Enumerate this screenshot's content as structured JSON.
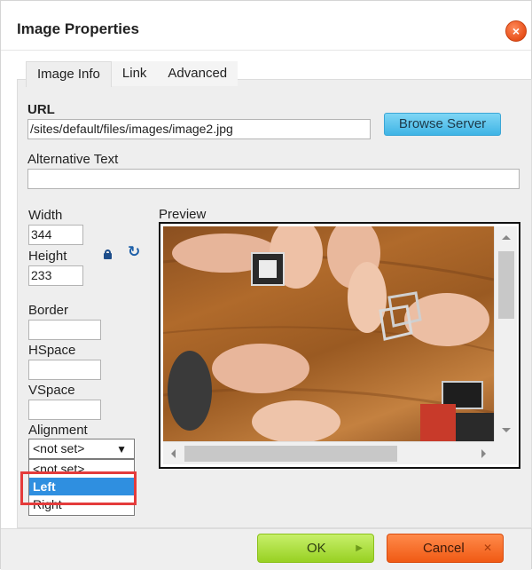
{
  "dialog": {
    "title": "Image Properties",
    "close_icon": "close-icon"
  },
  "tabs": [
    {
      "label": "Image Info",
      "active": true
    },
    {
      "label": "Link",
      "active": false
    },
    {
      "label": "Advanced",
      "active": false
    }
  ],
  "url": {
    "label": "URL",
    "value": "/sites/default/files/images/image2.jpg"
  },
  "browse_button": {
    "label": "Browse Server"
  },
  "alt_text": {
    "label": "Alternative Text",
    "value": ""
  },
  "width": {
    "label": "Width",
    "value": "344"
  },
  "height": {
    "label": "Height",
    "value": "233"
  },
  "lock_icon": "lock-icon",
  "reset_icon": "refresh-icon",
  "border": {
    "label": "Border",
    "value": ""
  },
  "hspace": {
    "label": "HSpace",
    "value": ""
  },
  "vspace": {
    "label": "VSpace",
    "value": ""
  },
  "alignment": {
    "label": "Alignment",
    "selected": "<not set>",
    "options": [
      "<not set>",
      "Left",
      "Right"
    ],
    "highlighted": "Left"
  },
  "preview": {
    "label": "Preview"
  },
  "buttons": {
    "ok": "OK",
    "cancel": "Cancel"
  },
  "colors": {
    "browse": "#3fb4e5",
    "ok": "#98d022",
    "cancel": "#f05a14",
    "close": "#e8501a",
    "dropdown_highlight": "#2f8fe0",
    "annotation": "#e43b3b"
  }
}
